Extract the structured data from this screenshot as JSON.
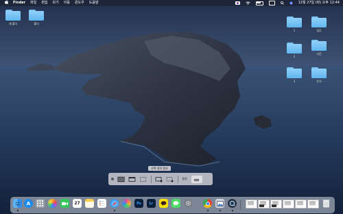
{
  "menubar": {
    "apple_icon": "apple-icon",
    "items": [
      "Finder",
      "파일",
      "편집",
      "보기",
      "이동",
      "윈도우",
      "도움말"
    ],
    "status_icons": [
      "input-source-flag-icon",
      "wifi-icon",
      "battery-icon",
      "control-center-icon",
      "search-icon",
      "siri-icon"
    ],
    "clock": "12월 27일 (화) 오후 12:44"
  },
  "desktop_left": [
    {
      "label": "새 폴더",
      "icon": "folder-icon"
    },
    {
      "label": "폴더",
      "icon": "folder-icon"
    }
  ],
  "desktop_right": [
    {
      "label": "1",
      "icon": "folder-icon"
    },
    {
      "label": "업무",
      "icon": "folder-icon"
    },
    {
      "label": "2",
      "icon": "folder-icon"
    },
    {
      "label": "사진",
      "icon": "folder-icon"
    },
    {
      "label": "3",
      "icon": "folder-icon"
    },
    {
      "label": "문서",
      "icon": "folder-icon"
    }
  ],
  "screenshot_toolbar": {
    "tooltip": "선택 영역 캡처",
    "buttons": [
      {
        "name": "capture-entire-screen-button",
        "icon": "entire-screen-icon",
        "selected": true
      },
      {
        "name": "capture-window-button",
        "icon": "window-icon",
        "selected": false
      },
      {
        "name": "capture-selection-button",
        "icon": "selection-icon",
        "selected": false
      },
      {
        "name": "record-entire-screen-button",
        "icon": "record-screen-icon",
        "selected": false
      },
      {
        "name": "record-selection-button",
        "icon": "record-selection-icon",
        "selected": false
      }
    ],
    "options_label": "옵션",
    "capture_icon": "capture-icon"
  },
  "dock": {
    "apps": [
      {
        "name": "finder",
        "icon": "finder-icon",
        "color": "#2f8fe8",
        "running": true
      },
      {
        "name": "app-store",
        "icon": "app-store-icon",
        "color": "#1d8cf0",
        "running": false,
        "badge": "1"
      },
      {
        "name": "launchpad",
        "icon": "launchpad-icon",
        "color": "#9aa0a8",
        "running": false
      },
      {
        "name": "photos",
        "icon": "photos-icon",
        "color": "#f4a83b",
        "running": false
      },
      {
        "name": "facetime",
        "icon": "facetime-icon",
        "color": "#34c759",
        "running": false
      },
      {
        "name": "calendar",
        "icon": "calendar-icon",
        "color": "#ffffff",
        "running": false
      },
      {
        "name": "notes",
        "icon": "notes-icon",
        "color": "#f7d14c",
        "running": false
      },
      {
        "name": "reminders",
        "icon": "reminders-icon",
        "color": "#ffffff",
        "running": false
      },
      {
        "name": "safari",
        "icon": "safari-icon",
        "color": "#3e9bf1",
        "running": true
      },
      {
        "name": "chrome-alt",
        "icon": "colorful-app-icon",
        "color": "#e94b8a",
        "running": false
      },
      {
        "name": "photoshop",
        "icon": "photoshop-icon",
        "color": "#0b1e3a",
        "running": false,
        "text": "Ps"
      },
      {
        "name": "lightroom",
        "icon": "lightroom-icon",
        "color": "#0b1e3a",
        "running": false,
        "text": "Lr"
      },
      {
        "name": "kakaotalk",
        "icon": "kakaotalk-icon",
        "color": "#f9e000",
        "running": false
      },
      {
        "name": "messages",
        "icon": "messages-icon",
        "color": "#4cd964",
        "running": false
      },
      {
        "name": "system-preferences",
        "icon": "gear-icon",
        "color": "#7b7f86",
        "running": false
      },
      {
        "name": "chrome",
        "icon": "chrome-icon",
        "color": "#ffffff",
        "running": true
      },
      {
        "name": "preview",
        "icon": "preview-icon",
        "color": "#d0d8e4",
        "running": true
      },
      {
        "name": "quicktime",
        "icon": "quicktime-icon",
        "color": "#2b3240",
        "running": true
      }
    ],
    "recent": [
      {
        "name": "recent-document-1",
        "icon": "document-thumbnail-icon"
      },
      {
        "name": "recent-document-2",
        "icon": "document-thumbnail-icon"
      },
      {
        "name": "recent-document-3",
        "icon": "document-thumbnail-icon"
      },
      {
        "name": "recent-document-4",
        "icon": "document-thumbnail-icon"
      },
      {
        "name": "recent-document-5",
        "icon": "document-thumbnail-icon"
      },
      {
        "name": "recent-document-6",
        "icon": "document-thumbnail-icon"
      }
    ],
    "trash_icon": "trash-icon"
  }
}
